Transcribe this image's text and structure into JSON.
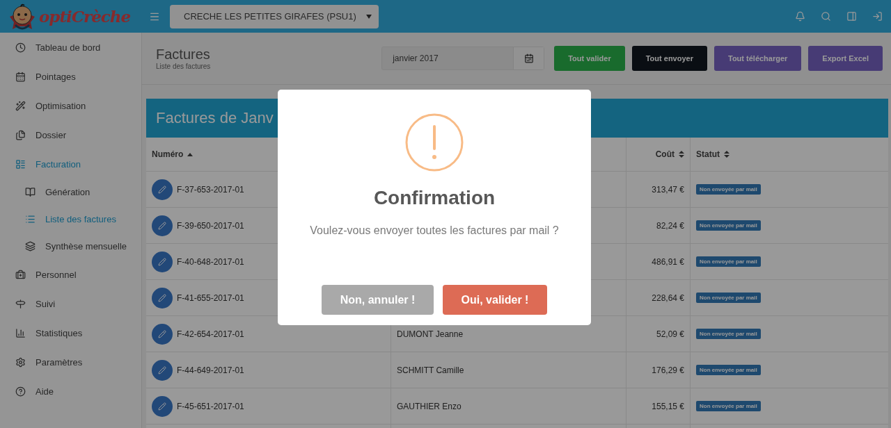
{
  "header": {
    "logo": "optiCrèche",
    "site_select": "CRECHE LES PETITES GIRAFES (PSU1)"
  },
  "sidebar": {
    "items": [
      {
        "label": "Tableau de bord",
        "selected": false
      },
      {
        "label": "Pointages",
        "selected": false
      },
      {
        "label": "Optimisation",
        "selected": false
      },
      {
        "label": "Dossier",
        "selected": false
      },
      {
        "label": "Facturation",
        "selected": true,
        "children": [
          {
            "label": "Génération",
            "selected": false
          },
          {
            "label": "Liste des factures",
            "selected": true
          },
          {
            "label": "Synthèse mensuelle",
            "selected": false
          }
        ]
      },
      {
        "label": "Personnel",
        "selected": false
      },
      {
        "label": "Suivi",
        "selected": false
      },
      {
        "label": "Statistiques",
        "selected": false
      },
      {
        "label": "Paramètres",
        "selected": false
      },
      {
        "label": "Aide",
        "selected": false
      }
    ]
  },
  "page": {
    "title": "Factures",
    "subtitle": "Liste des factures",
    "month_field": "janvier 2017",
    "buttons": [
      {
        "label": "Tout valider",
        "kind": "success"
      },
      {
        "label": "Tout envoyer",
        "kind": "dark"
      },
      {
        "label": "Tout télécharger",
        "kind": "purple"
      },
      {
        "label": "Export Excel",
        "kind": "purple"
      }
    ]
  },
  "panel": {
    "title": "Factures de Janv",
    "columns": [
      {
        "label": "Numéro",
        "sorted": true
      },
      {
        "label": "Coût",
        "sorted": false
      },
      {
        "label": "Statut",
        "sorted": false
      }
    ],
    "rows": [
      {
        "number": "F-37-653-2017-01",
        "cost": "313,47 €",
        "status": "Non envoyée par mail"
      },
      {
        "number": "F-39-650-2017-01",
        "cost": "82,24 €",
        "status": "Non envoyée par mail"
      },
      {
        "number": "F-40-648-2017-01",
        "cost": "486,91 €",
        "status": "Non envoyée par mail"
      },
      {
        "number": "F-41-655-2017-01",
        "cost": "228,64 €",
        "status": "Non envoyée par mail"
      },
      {
        "number": "F-42-654-2017-01",
        "name": "DUMONT Jeanne",
        "cost": "52,09 €",
        "status": "Non envoyée par mail"
      },
      {
        "number": "F-44-649-2017-01",
        "name": "SCHMITT Camille",
        "cost": "176,29 €",
        "status": "Non envoyée par mail"
      },
      {
        "number": "F-45-651-2017-01",
        "name": "GAUTHIER Enzo",
        "cost": "155,15 €",
        "status": "Non envoyée par mail"
      }
    ]
  },
  "modal": {
    "title": "Confirmation",
    "message": "Voulez-vous envoyer toutes les factures par mail ?",
    "buttons": [
      {
        "label": "Non, annuler !",
        "kind": "cancel"
      },
      {
        "label": "Oui, valider !",
        "kind": "confirm"
      }
    ]
  }
}
